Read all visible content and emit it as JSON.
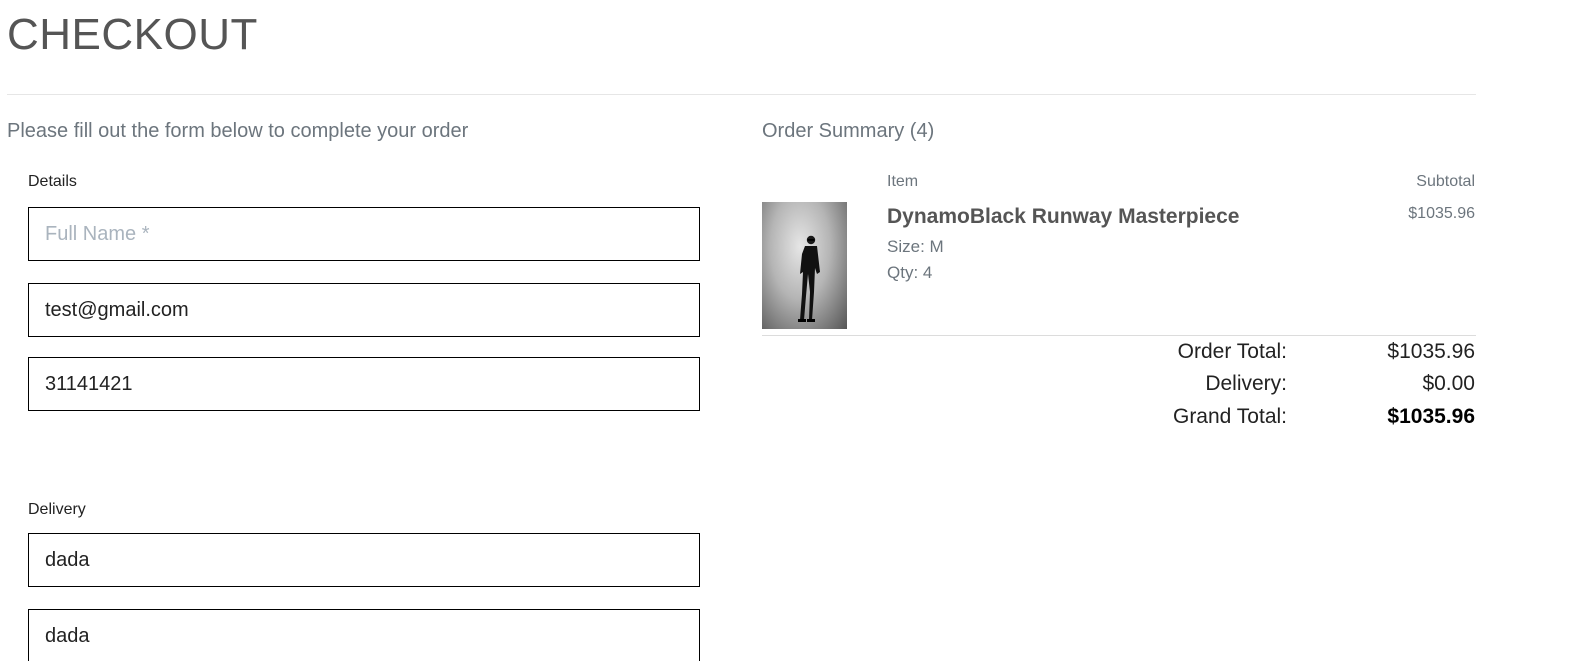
{
  "page": {
    "title": "CHECKOUT",
    "instruction": "Please fill out the form below to complete your order"
  },
  "details": {
    "label": "Details",
    "full_name": {
      "value": "",
      "placeholder": "Full Name *"
    },
    "email": {
      "value": "test@gmail.com"
    },
    "phone": {
      "value": "31141421"
    }
  },
  "delivery": {
    "label": "Delivery",
    "field1": {
      "value": "dada"
    },
    "field2": {
      "value": "dada"
    }
  },
  "summary": {
    "title": "Order Summary (4)",
    "col_item": "Item",
    "col_subtotal": "Subtotal",
    "product": {
      "name": "DynamoBlack Runway Masterpiece",
      "size": "Size: M",
      "qty": "Qty: 4",
      "price": "$1035.96",
      "image_icon": "product-photo-icon"
    },
    "order_total_label": "Order Total:",
    "order_total_value": "$1035.96",
    "delivery_label": "Delivery:",
    "delivery_value": "$0.00",
    "grand_total_label": "Grand Total:",
    "grand_total_value": "$1035.96"
  }
}
